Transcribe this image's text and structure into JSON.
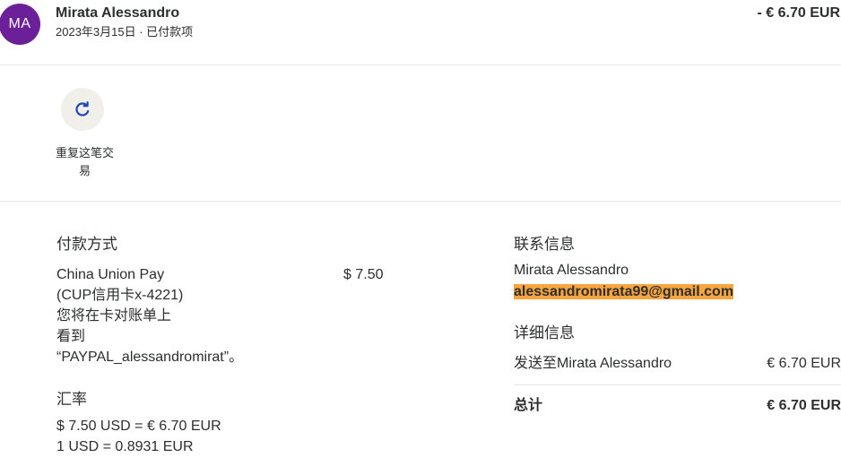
{
  "header": {
    "avatar_initials": "MA",
    "name": "Mirata Alessandro",
    "date_status": "2023年3月15日 · 已付款项",
    "amount": "- € 6.70 EUR"
  },
  "actions": {
    "repeat_icon": "refresh-icon",
    "repeat_label": "重复这笔交易"
  },
  "payment": {
    "heading": "付款方式",
    "method": [
      "China Union Pay",
      "(CUP信用卡x-4221)"
    ],
    "statement_note": [
      "您将在卡对账单上",
      "看到",
      "“PAYPAL_alessandromirat”。"
    ],
    "amount": "$ 7.50"
  },
  "exchange": {
    "heading": "汇率",
    "lines": [
      "$ 7.50 USD = € 6.70 EUR",
      "1 USD = 0.8931 EUR"
    ]
  },
  "contact": {
    "heading": "联系信息",
    "name": "Mirata Alessandro",
    "email": "alessandromirata99@gmail.com"
  },
  "details": {
    "heading": "详细信息",
    "rows": [
      {
        "label": "发送至Mirata Alessandro",
        "value": "€ 6.70 EUR"
      }
    ],
    "total_label": "总计",
    "total_value": "€ 6.70 EUR"
  },
  "colors": {
    "text": "#2c2e2f",
    "avatar": "#6b1f99",
    "action_icon": "#1d47b8",
    "action_bg": "#f1efea",
    "email_highlight": "#f9a53f",
    "divider": "#e6e6e6"
  }
}
